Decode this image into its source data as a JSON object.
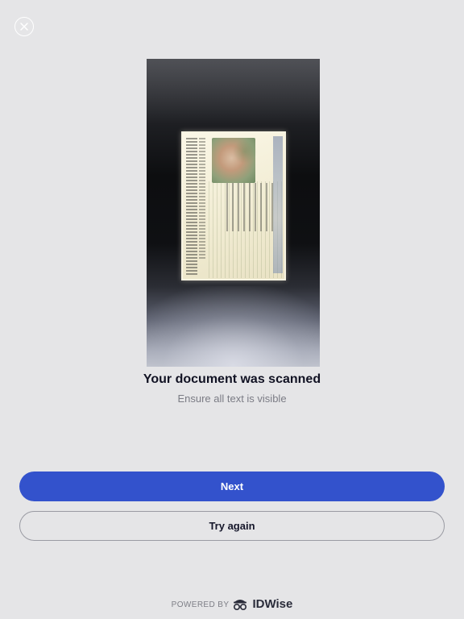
{
  "header": {
    "close_icon": "close-circle-icon"
  },
  "scan": {
    "title": "Your document was scanned",
    "subtitle": "Ensure all text is visible"
  },
  "actions": {
    "next_label": "Next",
    "retry_label": "Try again"
  },
  "footer": {
    "powered_by": "POWERED BY",
    "brand": "IDWise",
    "brand_icon": "idwise-logo-icon"
  },
  "colors": {
    "background": "#e5e5e7",
    "primary_button": "#3352cc",
    "title_text": "#111223",
    "subtitle_text": "#7b7c85"
  }
}
